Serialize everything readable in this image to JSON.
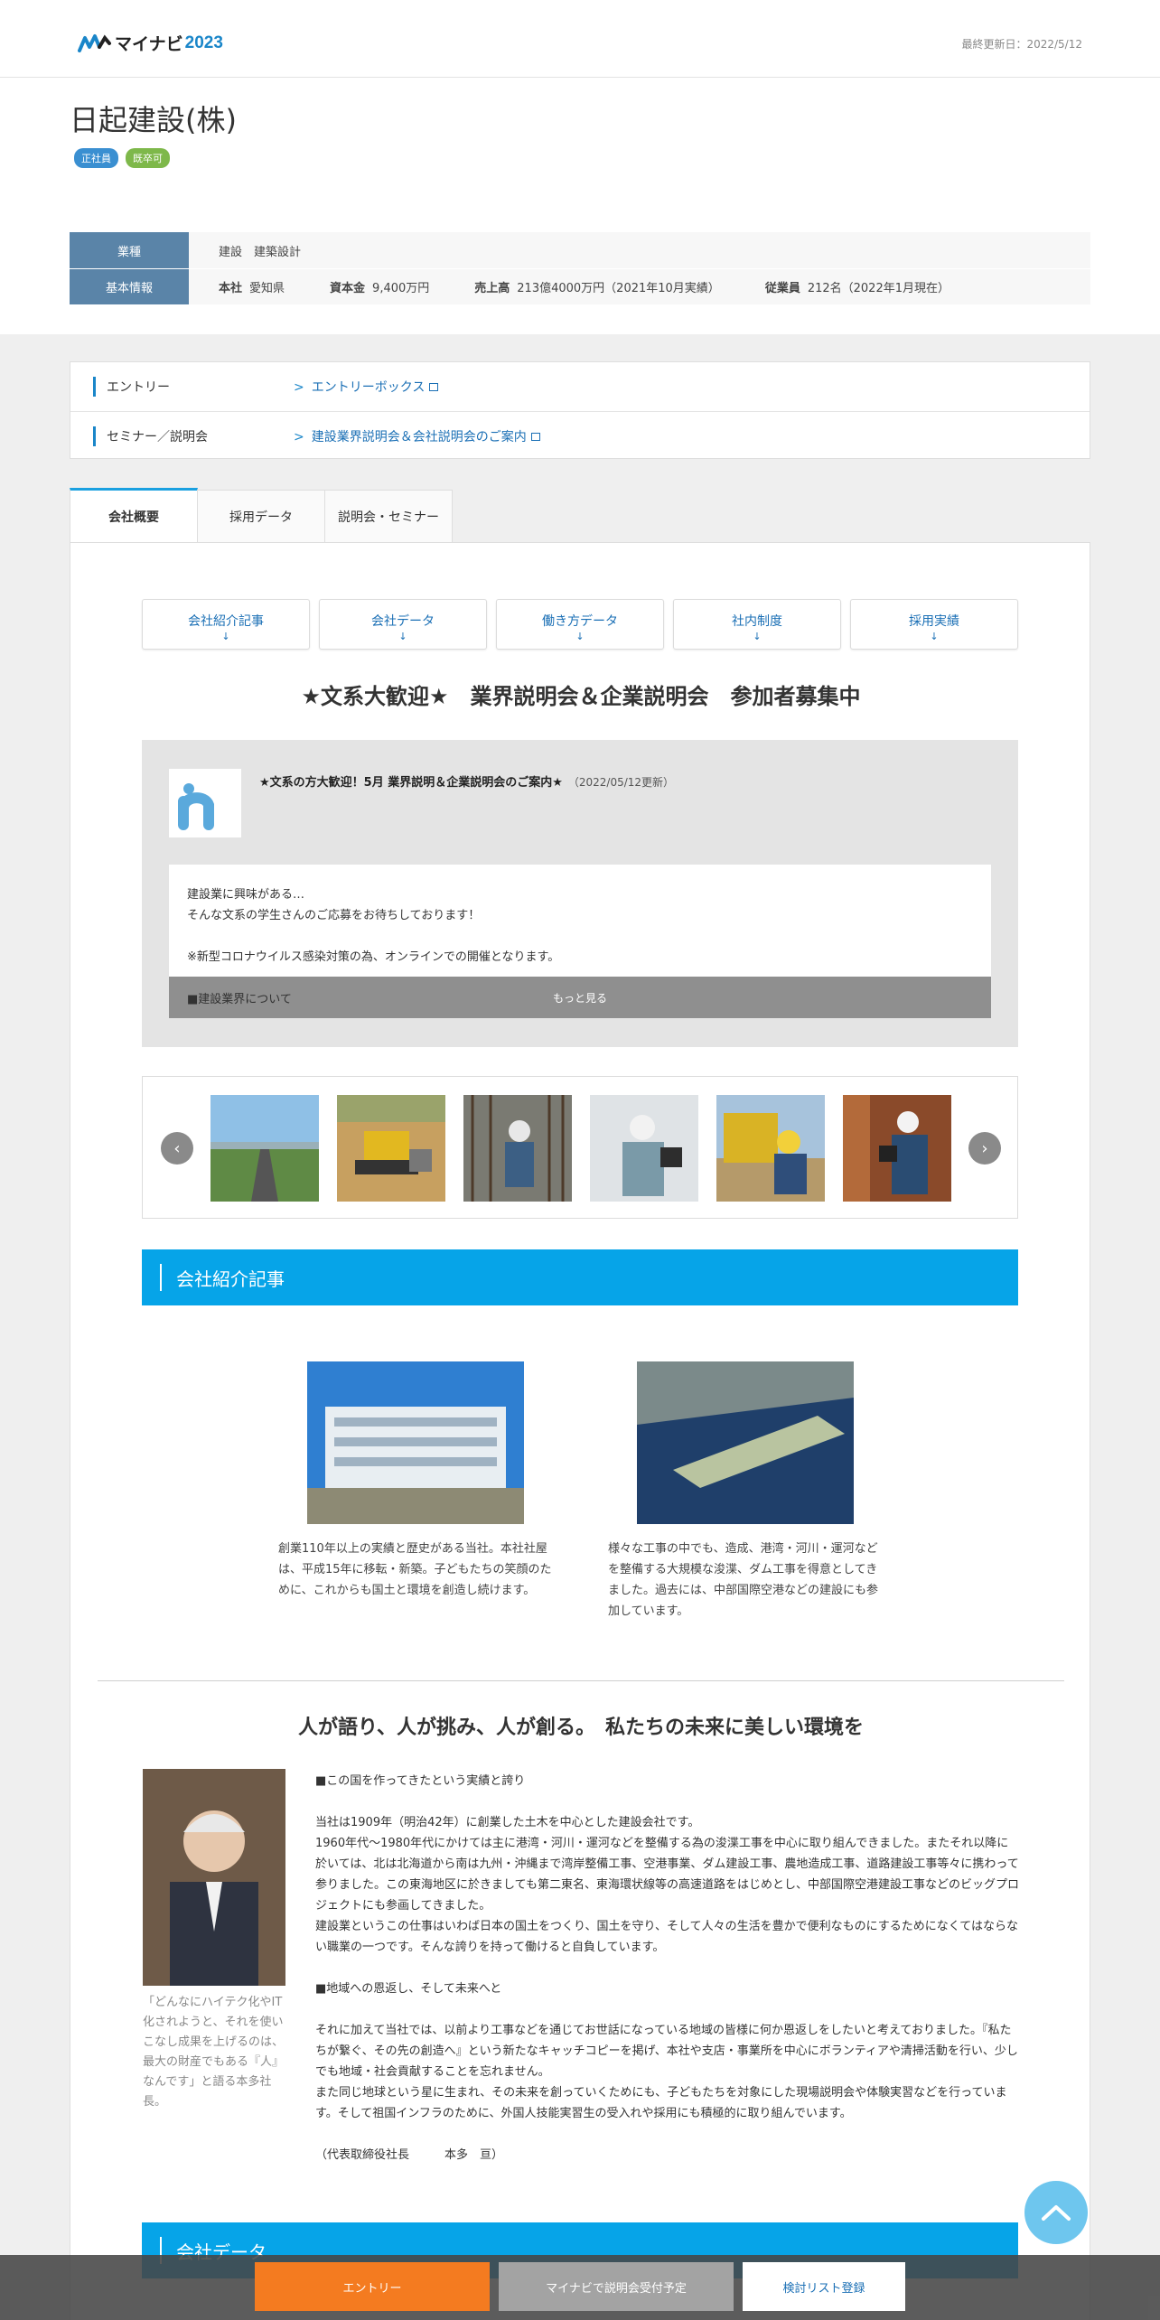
{
  "header": {
    "logo_text": "マイナビ",
    "logo_year": "2023",
    "updated": "最終更新日：2022/5/12"
  },
  "company": {
    "name": "日起建設(株)",
    "badges": [
      "正社員",
      "既卒可"
    ],
    "industry_key": "業種",
    "industry_val": "建設　建築設計",
    "basic_key": "基本情報",
    "hq_label": "本社",
    "hq_val": "愛知県",
    "capital_label": "資本金",
    "capital_val": "9,400万円",
    "sales_label": "売上高",
    "sales_val": "213億4000万円（2021年10月実績）",
    "emp_label": "従業員",
    "emp_val": "212名（2022年1月現在）"
  },
  "entry": {
    "rows": [
      {
        "label": "エントリー",
        "link": "エントリーボックス"
      },
      {
        "label": "セミナー／説明会",
        "link": "建設業界説明会＆会社説明会のご案内"
      }
    ]
  },
  "tabs": [
    "会社概要",
    "採用データ",
    "説明会・セミナー"
  ],
  "anchors": [
    "会社紹介記事",
    "会社データ",
    "働き方データ",
    "社内制度",
    "採用実績"
  ],
  "anchor_arrow": "↓",
  "headline": "★文系大歓迎★　業界説明会＆企業説明会　参加者募集中",
  "notice": {
    "title": "★文系の方大歓迎！5月 業界説明＆企業説明会のご案内★",
    "date": "（2022/05/12更新）",
    "lines": [
      "建設業に興味がある…",
      "そんな文系の学生さんのご応募をお待ちしております！",
      "",
      "※新型コロナウイルス感染対策の為、オンラインでの開催となります。"
    ],
    "foot_text": "■建設業界について",
    "more": "もっと見る"
  },
  "gallery": {
    "prev": "‹",
    "next": "›"
  },
  "section_intro": "会社紹介記事",
  "intro": [
    {
      "caption": "創業110年以上の実績と歴史がある当社。本社社屋は、平成15年に移転・新築。子どもたちの笑顔のために、これからも国土と環境を創造し続けます。"
    },
    {
      "caption": "様々な工事の中でも、造成、港湾・河川・運河などを整備する大規模な浚渫、ダム工事を得意としてきました。過去には、中部国際空港などの建設にも参加しています。"
    }
  ],
  "headline2": "人が語り、人が挑み、人が創る。　私たちの未来に美しい環境を",
  "portrait_caption": "「どんなにハイテク化やIT化されようと、それを使いこなし成果を上げるのは、最大の財産でもある『人』なんです」と語る本多社長。",
  "story": [
    "■この国を作ってきたという実績と誇り",
    "",
    "当社は1909年（明治42年）に創業した土木を中心とした建設会社です。",
    "1960年代～1980年代にかけては主に港湾・河川・運河などを整備する為の浚渫工事を中心に取り組んできました。またそれ以降に於いては、北は北海道から南は九州・沖縄まで湾岸整備工事、空港事業、ダム建設工事、農地造成工事、道路建設工事等々に携わって参りました。この東海地区に於きましても第二東名、東海環状線等の高速道路をはじめとし、中部国際空港建設工事などのビッグプロジェクトにも参画してきました。",
    "建設業というこの仕事はいわば日本の国土をつくり、国土を守り、そして人々の生活を豊かで便利なものにするためになくてはならない職業の一つです。そんな誇りを持って働けると自負しています。",
    "",
    "■地域への恩返し、そして未来へと",
    "",
    "それに加えて当社では、以前より工事などを通じてお世話になっている地域の皆様に何か恩返しをしたいと考えておりました。『私たちが繋ぐ、その先の創造へ』という新たなキャッチコピーを掲げ、本社や支店・事業所を中心にボランティアや清掃活動を行い、少しでも地域・社会貢献することを忘れません。",
    "また同じ地球という星に生まれ、その未来を創っていくためにも、子どもたちを対象にした現場説明会や体験実習などを行っています。そして祖国インフラのために、外国人技能実習生の受入れや採用にも積極的に取り組んでいます。",
    "",
    "（代表取締役社長　　　本多　亘）"
  ],
  "section_data": "会社データ",
  "bottom": {
    "entry": "エントリー",
    "seminar": "マイナビで説明会受付予定",
    "list": "検討リスト登録"
  },
  "colors": {
    "accent": "#06a4e8",
    "entry": "#f47b20",
    "key_bg": "#5a84a8"
  }
}
